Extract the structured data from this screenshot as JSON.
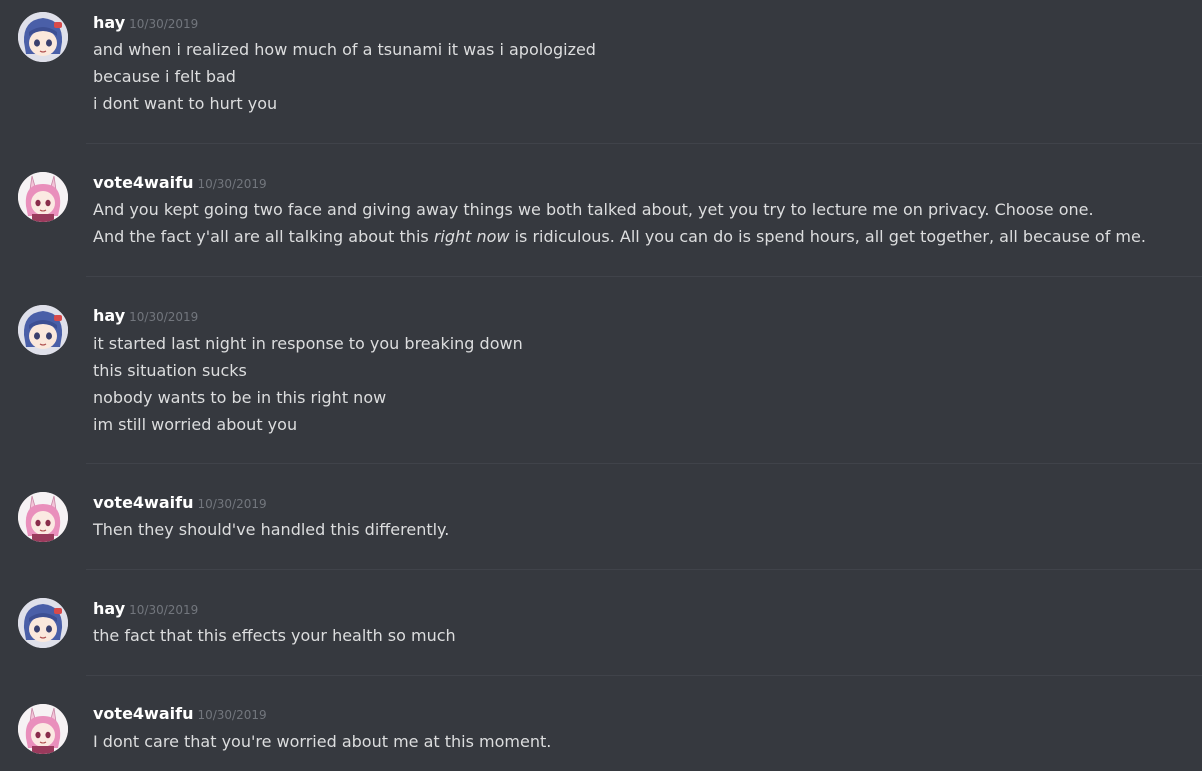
{
  "messages": [
    {
      "username": "hay",
      "timestamp": "10/30/2019",
      "avatar": "hay-avatar",
      "lines": [
        "and when i realized how much of a tsunami it was i apologized",
        "because i felt bad",
        "i dont want to hurt you"
      ]
    },
    {
      "username": "vote4waifu",
      "timestamp": "10/30/2019",
      "avatar": "vote4waifu-avatar",
      "lines": [
        "And you kept going two face and giving away things we both talked about, yet you try to lecture me on privacy. Choose one.",
        "And the fact y'all are all talking about this "
      ],
      "line2_italic": "right now",
      "line2_tail": " is ridiculous. All you can do is spend hours, all get together, all because of me."
    },
    {
      "username": "hay",
      "timestamp": "10/30/2019",
      "avatar": "hay-avatar",
      "lines": [
        "it started last night in response to you breaking down",
        "this situation sucks",
        "nobody wants to be in this right now",
        "im still worried about you"
      ]
    },
    {
      "username": "vote4waifu",
      "timestamp": "10/30/2019",
      "avatar": "vote4waifu-avatar",
      "lines": [
        "Then they should've handled this differently."
      ]
    },
    {
      "username": "hay",
      "timestamp": "10/30/2019",
      "avatar": "hay-avatar",
      "lines": [
        "the fact that this effects your health so much"
      ]
    },
    {
      "username": "vote4waifu",
      "timestamp": "10/30/2019",
      "avatar": "vote4waifu-avatar",
      "lines": [
        "I dont care that you're worried about me at this moment."
      ]
    }
  ],
  "colors": {
    "background": "#36393f",
    "username": "#ffffff",
    "timestamp": "#72767d",
    "message_text": "#dcddde",
    "divider": "#40434a"
  }
}
